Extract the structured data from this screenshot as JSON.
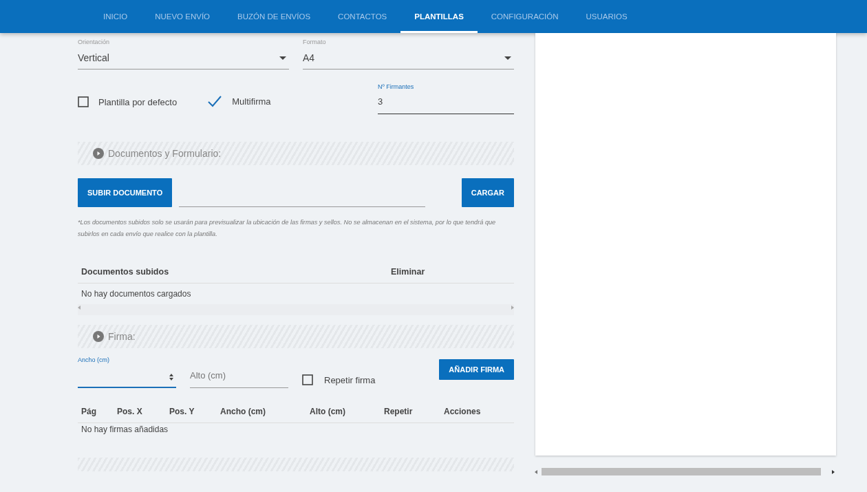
{
  "nav": {
    "tabs": [
      {
        "label": "INICIO",
        "selected": false
      },
      {
        "label": "NUEVO ENVÍO",
        "selected": false
      },
      {
        "label": "BUZÓN DE ENVÍOS",
        "selected": false
      },
      {
        "label": "CONTACTOS",
        "selected": false
      },
      {
        "label": "PLANTILLAS",
        "selected": true
      },
      {
        "label": "CONFIGURACIÓN",
        "selected": false
      },
      {
        "label": "USUARIOS",
        "selected": false
      }
    ]
  },
  "form": {
    "orientation": {
      "label": "Orientación",
      "value": "Vertical"
    },
    "format": {
      "label": "Formato",
      "value": "A4"
    },
    "default_template": {
      "label": "Plantilla por defecto",
      "checked": false
    },
    "multisign": {
      "label": "Multifirma",
      "checked": true
    },
    "signers": {
      "label": "Nº Firmantes",
      "value": "3"
    }
  },
  "documents": {
    "title": "Documentos y Formulario:",
    "upload_button": "SUBIR DOCUMENTO",
    "load_button": "CARGAR",
    "note": "*Los documentos subidos solo se usarán para previsualizar la ubicación de las firmas y sellos. No se almacenan en el sistema, por lo que tendrá que subirlos en cada envío que realice con la plantilla.",
    "columns": [
      "Documentos subidos",
      "Eliminar"
    ],
    "empty": "No hay documentos cargados"
  },
  "signature": {
    "title": "Firma:",
    "width_field": {
      "label": "Ancho (cm)",
      "focused": true
    },
    "height_field": {
      "placeholder": "Alto (cm)"
    },
    "repeat": {
      "label": "Repetir firma",
      "checked": false
    },
    "add_button": "AÑADIR FIRMA",
    "columns": [
      "Pág",
      "Pos. X",
      "Pos. Y",
      "Ancho (cm)",
      "Alto (cm)",
      "Repetir",
      "Acciones"
    ],
    "empty": "No hay firmas añadidas"
  }
}
